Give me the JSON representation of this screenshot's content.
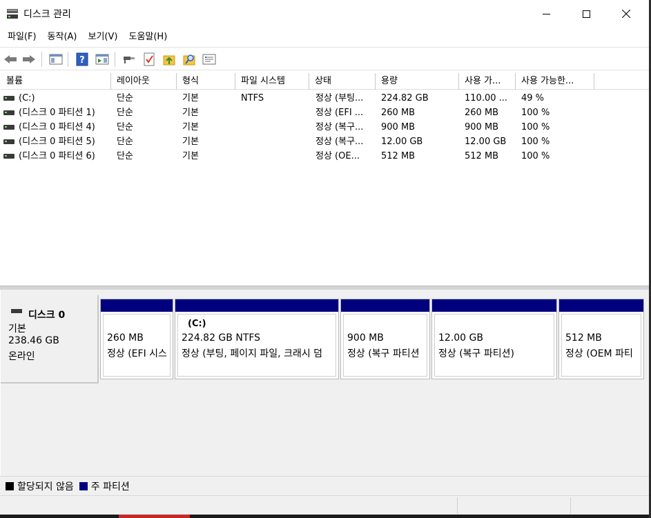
{
  "window": {
    "title": "디스크 관리",
    "minimize_glyph": "─",
    "maximize_glyph": "☐",
    "close_glyph": "✕"
  },
  "menu": [
    {
      "label": "파일(F)"
    },
    {
      "label": "동작(A)"
    },
    {
      "label": "보기(V)"
    },
    {
      "label": "도움말(H)"
    }
  ],
  "toolbar_icons": [
    "back-arrow-icon",
    "forward-arrow-icon",
    "console-tree-icon",
    "help-icon",
    "action-pane-icon",
    "connect-icon",
    "checklist-icon",
    "up-folder-icon",
    "find-icon",
    "properties-icon"
  ],
  "columns": [
    {
      "label": "볼륨"
    },
    {
      "label": "레이아웃"
    },
    {
      "label": "형식"
    },
    {
      "label": "파일 시스템"
    },
    {
      "label": "상태"
    },
    {
      "label": "용량"
    },
    {
      "label": "사용 가..."
    },
    {
      "label": "사용 가능한..."
    }
  ],
  "volumes": [
    {
      "name": "(C:)",
      "layout": "단순",
      "type": "기본",
      "fs": "NTFS",
      "status": "정상 (부팅...",
      "capacity": "224.82 GB",
      "free": "110.00 ...",
      "pct": "49 %"
    },
    {
      "name": "(디스크 0 파티션 1)",
      "layout": "단순",
      "type": "기본",
      "fs": "",
      "status": "정상 (EFI ...",
      "capacity": "260 MB",
      "free": "260 MB",
      "pct": "100 %"
    },
    {
      "name": "(디스크 0 파티션 4)",
      "layout": "단순",
      "type": "기본",
      "fs": "",
      "status": "정상 (복구...",
      "capacity": "900 MB",
      "free": "900 MB",
      "pct": "100 %"
    },
    {
      "name": "(디스크 0 파티션 5)",
      "layout": "단순",
      "type": "기본",
      "fs": "",
      "status": "정상 (복구...",
      "capacity": "12.00 GB",
      "free": "12.00 GB",
      "pct": "100 %"
    },
    {
      "name": "(디스크 0 파티션 6)",
      "layout": "단순",
      "type": "기본",
      "fs": "",
      "status": "정상 (OE...",
      "capacity": "512 MB",
      "free": "512 MB",
      "pct": "100 %"
    }
  ],
  "disk": {
    "name": "디스크 0",
    "type": "기본",
    "size": "238.46 GB",
    "status": "온라인"
  },
  "partitions": [
    {
      "name": "",
      "size": "260 MB",
      "status": "정상 (EFI 시스"
    },
    {
      "name": "(C:)",
      "size": "224.82 GB NTFS",
      "status": "정상 (부팅, 페이지 파일, 크래시 덤"
    },
    {
      "name": "",
      "size": "900 MB",
      "status": "정상 (복구 파티션"
    },
    {
      "name": "",
      "size": "12.00 GB",
      "status": "정상 (복구 파티션)"
    },
    {
      "name": "",
      "size": "512 MB",
      "status": "정상 (OEM 파티"
    }
  ],
  "legend": [
    {
      "label": "할당되지 않음",
      "color": "#000000"
    },
    {
      "label": "주 파티션",
      "color": "#00007f"
    }
  ],
  "colors": {
    "primary_partition": "#00007f",
    "unallocated": "#000000",
    "pane_background": "#f0f0f0"
  }
}
